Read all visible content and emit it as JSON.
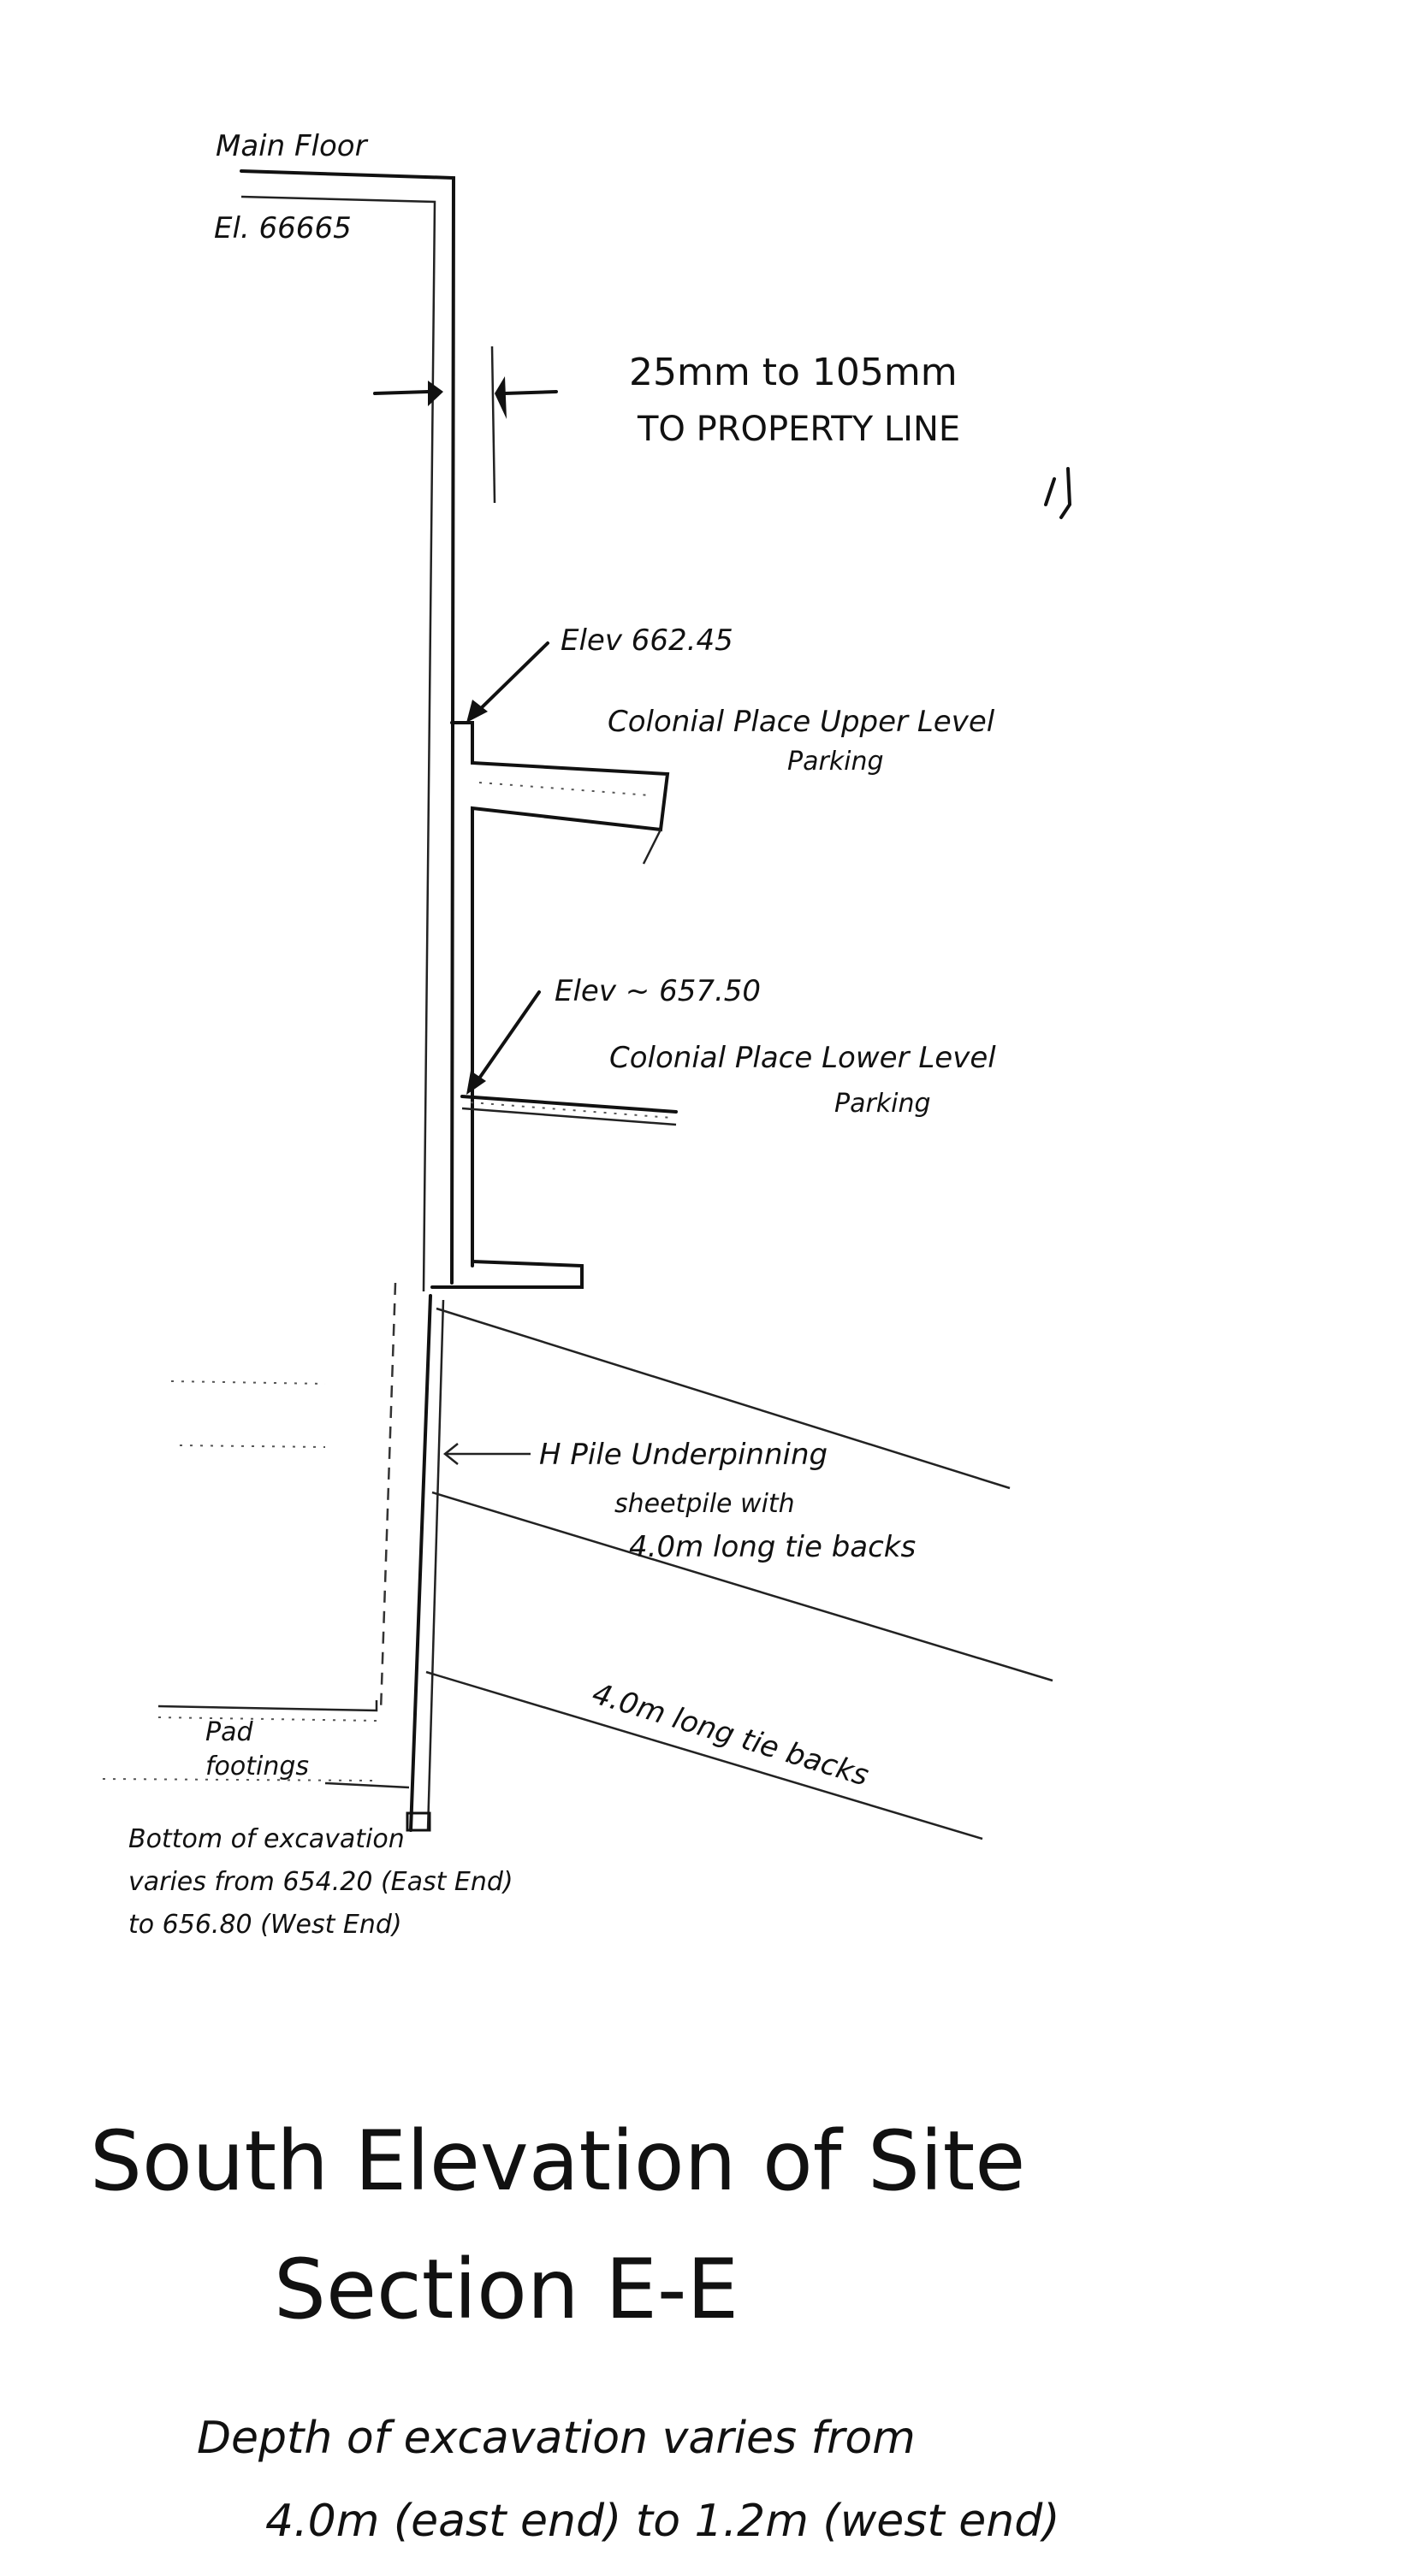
{
  "drawing": {
    "main_floor_label": "Main Floor",
    "main_floor_elevation": "El. 66665",
    "clearance_line1": "25mm to 105mm",
    "clearance_line2": "TO PROPERTY LINE",
    "upper_elevation": "Elev 662.45",
    "upper_parking_line1": "Colonial Place Upper Level",
    "upper_parking_line2": "Parking",
    "lower_elevation": "Elev ~ 657.50",
    "lower_parking_line1": "Colonial Place Lower Level",
    "lower_parking_line2": "Parking",
    "pile_label_line1": "H Pile Underpinning",
    "pile_label_line2": "sheetpile with",
    "pile_label_line3": "4.0m long tie backs",
    "tieback_label": "4.0m long tie backs",
    "pad_label_line1": "Pad",
    "pad_label_line2": "footings",
    "bottom_line1": "Bottom of excavation",
    "bottom_line2": "varies from 654.20 (East End)",
    "bottom_line3": "to 656.80 (West End)"
  },
  "title": {
    "main": "South Elevation of Site",
    "section": "Section E-E",
    "note_line1": "Depth of excavation varies from",
    "note_line2": "4.0m (east end) to 1.2m (west end)"
  }
}
